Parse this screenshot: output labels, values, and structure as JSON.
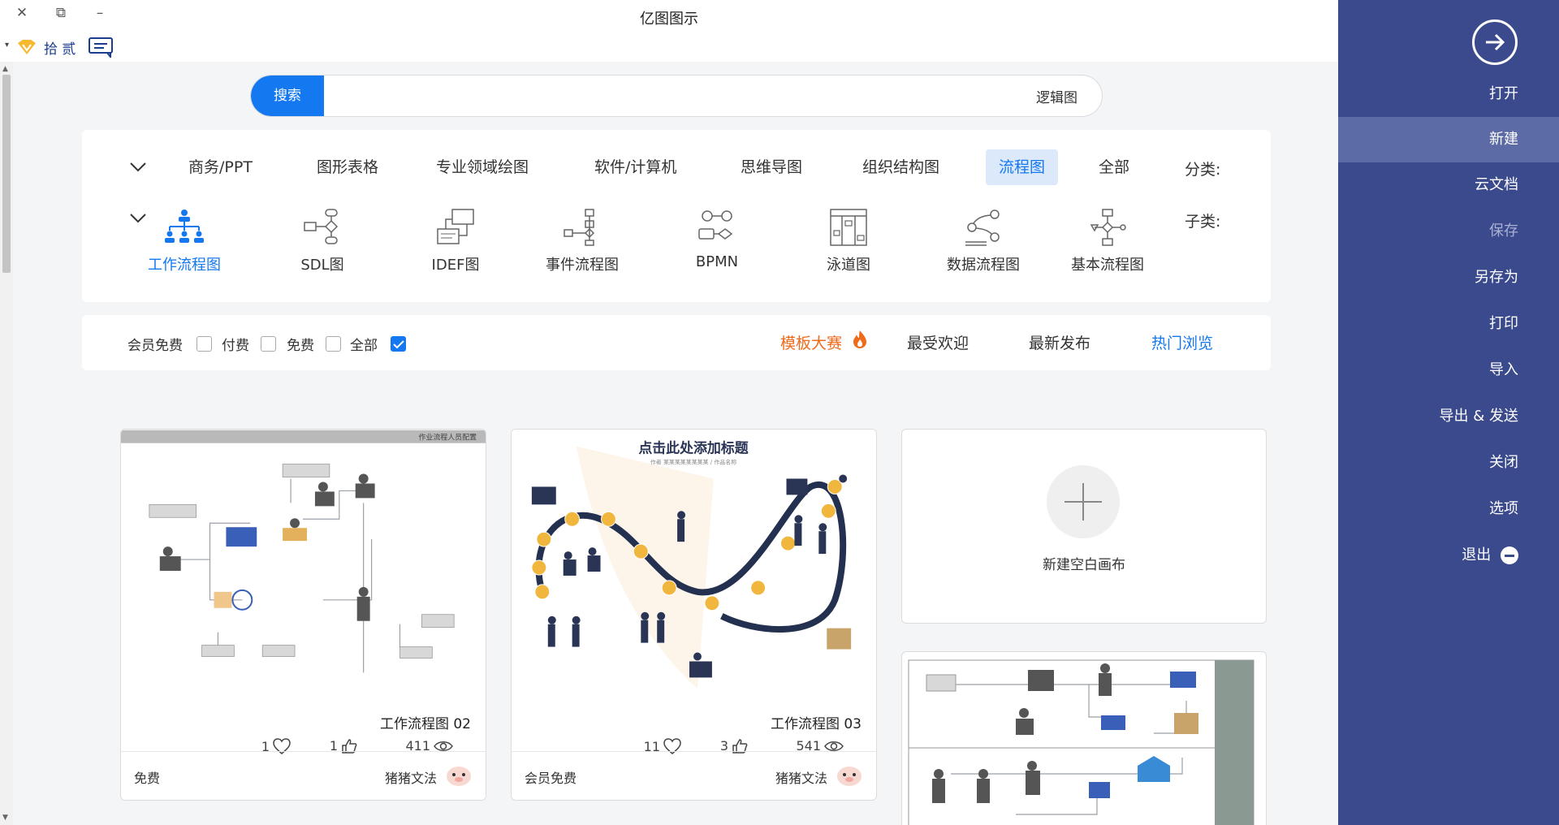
{
  "window": {
    "title": "亿图图示",
    "close": "✕",
    "restore": "⧉",
    "minimize": "–"
  },
  "user": {
    "name": "拾 贰",
    "dropdown": "▾"
  },
  "search": {
    "button": "搜索",
    "query": "逻辑图"
  },
  "categories": {
    "label": "分类:",
    "items": [
      "全部",
      "流程图",
      "组织结构图",
      "思维导图",
      "软件/计算机",
      "专业领域绘图",
      "图形表格",
      "商务/PPT"
    ],
    "active": "流程图"
  },
  "subcategories": {
    "label": "子类:",
    "items": [
      "基本流程图",
      "数据流程图",
      "泳道图",
      "BPMN",
      "事件流程图",
      "IDEF图",
      "SDL图",
      "工作流程图"
    ],
    "active": "工作流程图"
  },
  "filters": {
    "tabs": [
      "热门浏览",
      "最新发布",
      "最受欢迎",
      "模板大赛"
    ],
    "price_options": [
      "全部",
      "免费",
      "付费",
      "会员免费"
    ]
  },
  "blank_card": {
    "label": "新建空白画布"
  },
  "cards": [
    {
      "title": "工作流程图 03",
      "views": "541",
      "likes": "3",
      "favorites": "11",
      "author": "猪猪文法",
      "price": "会员免费",
      "header": "点击此处添加标题",
      "subheader": "作者 某某某某某某某某 / 作品名称"
    },
    {
      "title": "工作流程图 02",
      "views": "411",
      "likes": "1",
      "favorites": "1",
      "author": "猪猪文法",
      "price": "免费",
      "header": "作业流程人员配置"
    }
  ],
  "sidebar": {
    "items": [
      "打开",
      "新建",
      "云文档",
      "保存",
      "另存为",
      "打印",
      "导入",
      "导出 & 发送",
      "关闭",
      "选项",
      "退出"
    ],
    "active": "新建",
    "disabled": [
      "保存"
    ]
  },
  "colors": {
    "accent": "#1478f0",
    "sidebar": "#3a4a8c",
    "sidebar_active": "#5c6aa6",
    "contest": "#f06a1c"
  }
}
